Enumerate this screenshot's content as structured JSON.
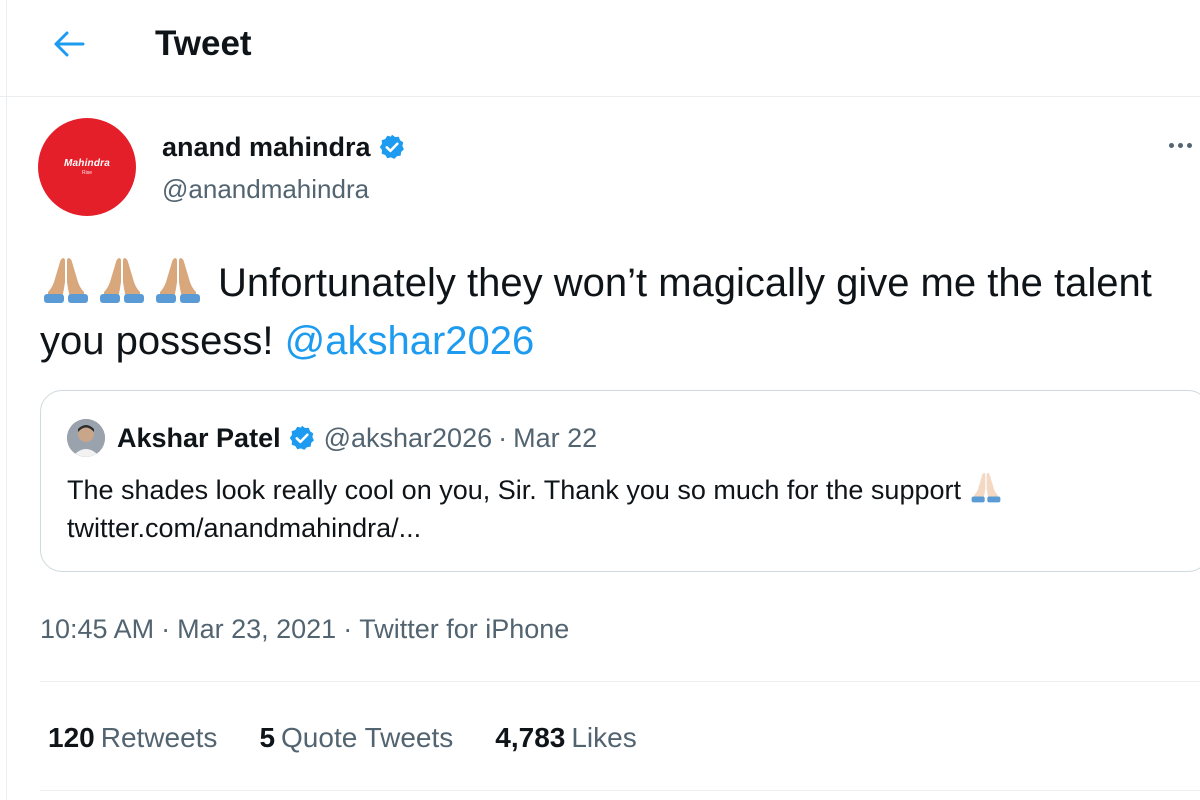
{
  "header": {
    "title": "Tweet",
    "back_icon": "arrow-left-icon"
  },
  "author": {
    "name": "anand mahindra",
    "handle": "@anandmahindra",
    "verified": true,
    "avatar_logo_text": "Mahindra",
    "avatar_logo_sub": "Rise"
  },
  "tweet": {
    "emojis": [
      "🙏",
      "🙏",
      "🙏"
    ],
    "text": "Unfortunately they won’t magically give me the talent you possess!",
    "mention": "@akshar2026"
  },
  "quote": {
    "name": "Akshar Patel",
    "handle": "@akshar2026",
    "separator": "·",
    "date": "Mar 22",
    "text": "The shades look really cool on you, Sir. Thank you so much for the support",
    "link": "twitter.com/anandmahindra/..."
  },
  "meta": {
    "time": "10:45 AM",
    "date": "Mar 23, 2021",
    "source": "Twitter for iPhone",
    "separator": "·"
  },
  "stats": {
    "retweets_count": "120",
    "retweets_label": "Retweets",
    "quotes_count": "5",
    "quotes_label": "Quote Tweets",
    "likes_count": "4,783",
    "likes_label": "Likes"
  },
  "colors": {
    "accent": "#1d9bf0",
    "text": "#0f1419",
    "secondary": "#536471",
    "border": "#cfd9de",
    "brand_red": "#e51f2a"
  }
}
